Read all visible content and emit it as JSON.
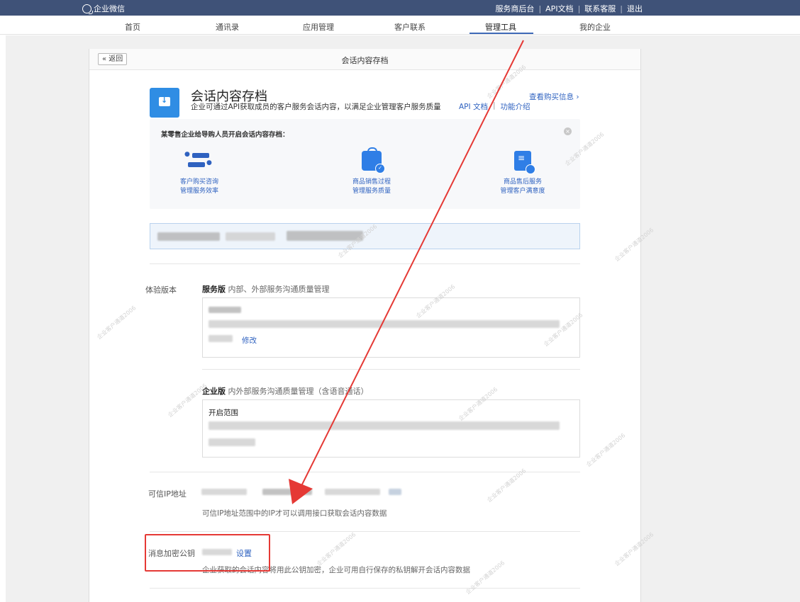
{
  "topbar": {
    "logo_text": "企业微信",
    "links": [
      "服务商后台",
      "API文档",
      "联系客服",
      "退出"
    ],
    "separator": "|"
  },
  "nav": {
    "items": [
      {
        "label": "首页",
        "active": false
      },
      {
        "label": "通讯录",
        "active": false
      },
      {
        "label": "应用管理",
        "active": false
      },
      {
        "label": "客户联系",
        "active": false
      },
      {
        "label": "管理工具",
        "active": true
      },
      {
        "label": "我的企业",
        "active": false
      }
    ]
  },
  "card": {
    "back_label": "« 返回",
    "title": "会话内容存档"
  },
  "app": {
    "title": "会话内容存档",
    "description": "企业可通过API获取成员的客户服务会话内容，以满足企业管理客户服务质量",
    "api_doc_link": "API 文档",
    "intro_link": "功能介绍",
    "link_separator": "|",
    "buy_info_link": "查看购买信息 ›"
  },
  "example": {
    "title": "某零售企业给导购人员开启会话内容存档：",
    "close_glyph": "×",
    "items": [
      {
        "icon": "chat-icon",
        "line1": "客户购买咨询",
        "line2": "管理服务效率"
      },
      {
        "icon": "shopping-bag-icon",
        "line1": "商品销售过程",
        "line2": "管理服务质量"
      },
      {
        "icon": "document-icon",
        "line1": "商品售后服务",
        "line2": "管理客户满意度"
      }
    ]
  },
  "trial": {
    "label": "体验版本",
    "service": {
      "name": "服务版",
      "desc": "内部、外部服务沟通质量管理",
      "edit_link": "修改"
    },
    "enterprise": {
      "name": "企业版",
      "desc": "内外部服务沟通质量管理（含语音通话）",
      "scope_label": "开启范围"
    }
  },
  "trusted_ip": {
    "label": "可信IP地址",
    "hint": "可信IP地址范围中的IP才可以调用接口获取会话内容数据"
  },
  "encryption": {
    "label": "消息加密公钥",
    "set_link": "设置",
    "hint": "企业获取的会话内容将用此公钥加密，企业可用自行保存的私钥解开会话内容数据"
  },
  "watermark_text": "企业客户通道2006",
  "colors": {
    "topbar": "#3f5278",
    "accent": "#2f62c0",
    "annotation": "#e53935"
  }
}
